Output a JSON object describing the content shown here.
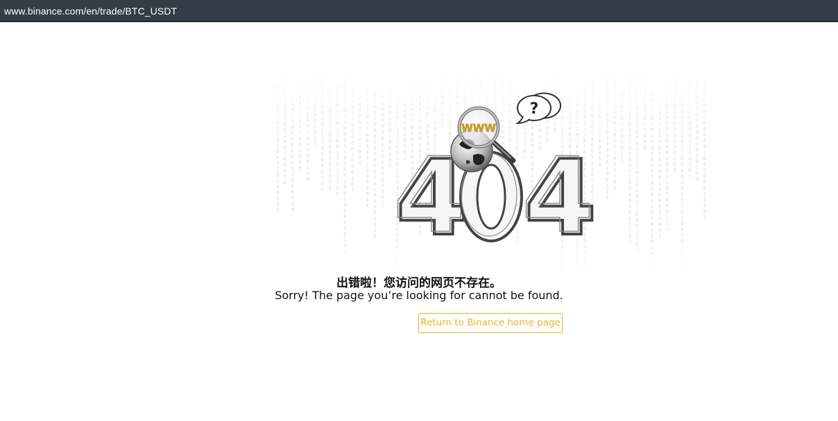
{
  "browser": {
    "url": "www.binance.com/en/trade/BTC_USDT"
  },
  "error": {
    "code_digits": [
      "4",
      "0",
      "4"
    ],
    "www_badge": "WWW",
    "question_mark": "?",
    "message_cn": "出错啦！您访问的网页不存在。",
    "message_en": "Sorry! The page you’re looking for cannot be found."
  },
  "actions": {
    "home_button_label": "Return to Binance home page"
  },
  "colors": {
    "accent": "#e5b22c",
    "url_bar": "#343c47",
    "digit_outline": "#444444"
  }
}
